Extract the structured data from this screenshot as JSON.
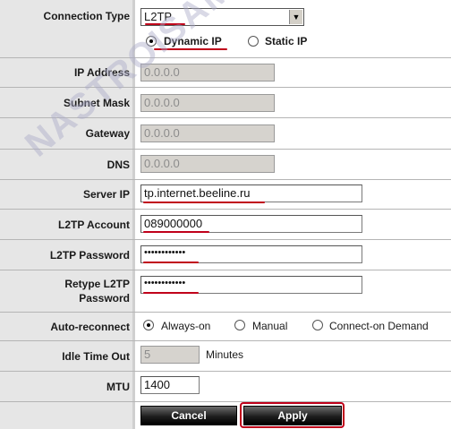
{
  "connection_type": {
    "label": "Connection Type",
    "value": "L2TP",
    "options": {
      "dynamic": "Dynamic IP",
      "static": "Static IP",
      "selected": "dynamic"
    }
  },
  "ip_address": {
    "label": "IP Address",
    "value": "0.0.0.0"
  },
  "subnet_mask": {
    "label": "Subnet Mask",
    "value": "0.0.0.0"
  },
  "gateway": {
    "label": "Gateway",
    "value": "0.0.0.0"
  },
  "dns": {
    "label": "DNS",
    "value": "0.0.0.0"
  },
  "server_ip": {
    "label": "Server IP",
    "value": "tp.internet.beeline.ru"
  },
  "account": {
    "label": "L2TP Account",
    "value": "089000000"
  },
  "password": {
    "label": "L2TP Password",
    "value": "••••••••••••"
  },
  "retype": {
    "label_line1": "Retype L2TP",
    "label_line2": "Password",
    "value": "••••••••••••"
  },
  "auto_reconnect": {
    "label": "Auto-reconnect",
    "opt1": "Always-on",
    "opt2": "Manual",
    "opt3": "Connect-on Demand",
    "selected": "opt1"
  },
  "idle": {
    "label": "Idle Time Out",
    "value": "5",
    "unit": "Minutes"
  },
  "mtu": {
    "label": "MTU",
    "value": "1400"
  },
  "buttons": {
    "cancel": "Cancel",
    "apply": "Apply"
  },
  "watermark": "NASTROISAM.RU",
  "colors": {
    "highlight": "#c0001a",
    "label_bg": "#e6e6e6"
  }
}
